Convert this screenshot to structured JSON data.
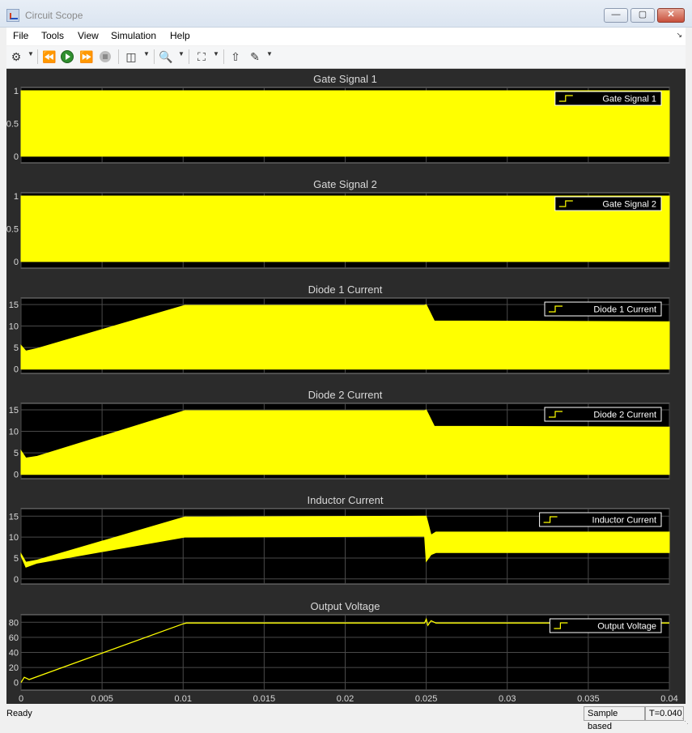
{
  "window": {
    "title": "Circuit Scope",
    "minimize_glyph": "—",
    "maximize_glyph": "▢",
    "close_glyph": "✕"
  },
  "menu": {
    "items": [
      "File",
      "Tools",
      "View",
      "Simulation",
      "Help"
    ]
  },
  "toolbar": {
    "icons": [
      "gear-icon",
      "step-back-icon",
      "run-icon",
      "step-forward-icon",
      "stop-icon",
      "signal-selector-icon",
      "zoom-in-icon",
      "autoscale-icon",
      "highlight-block-icon",
      "style-icon"
    ]
  },
  "status": {
    "left": "Ready",
    "sample": "Sample based",
    "time": "T=0.040"
  },
  "colors": {
    "background": "#2b2b2b",
    "axes": "#000000",
    "signal": "#ffff00",
    "grid": "#4a4a4a",
    "label": "#d9d9d9"
  },
  "chart_data": [
    {
      "type": "area",
      "title": "Gate Signal 1",
      "legend": "Gate Signal 1",
      "legend_position": "top-right",
      "ylim": [
        -0.1,
        1.05
      ],
      "yticks": [
        "0",
        "0.5",
        "1"
      ],
      "ytick_values": [
        0,
        0.5,
        1
      ],
      "grid": true,
      "envelope": {
        "x": [
          0,
          0.04
        ],
        "lower": [
          0,
          0
        ],
        "upper": [
          1,
          1
        ]
      }
    },
    {
      "type": "area",
      "title": "Gate Signal 2",
      "legend": "Gate Signal 2",
      "legend_position": "top-right",
      "ylim": [
        -0.1,
        1.05
      ],
      "yticks": [
        "0",
        "0.5",
        "1"
      ],
      "ytick_values": [
        0,
        0.5,
        1
      ],
      "grid": true,
      "envelope": {
        "x": [
          0,
          0.04
        ],
        "lower": [
          0,
          0
        ],
        "upper": [
          1,
          1
        ]
      }
    },
    {
      "type": "area",
      "title": "Diode 1 Current",
      "legend": "Diode 1 Current",
      "legend_position": "top-right",
      "ylim": [
        -1,
        16.5
      ],
      "yticks": [
        "0",
        "5",
        "10",
        "15"
      ],
      "ytick_values": [
        0,
        5,
        10,
        15
      ],
      "grid": true,
      "envelope": {
        "x": [
          0,
          0.0003,
          0.001,
          0.0101,
          0.0249,
          0.025,
          0.0255,
          0.04
        ],
        "lower": [
          0,
          0,
          0,
          0,
          0,
          0,
          0,
          0
        ],
        "upper": [
          5.5,
          4.2,
          4.8,
          14.8,
          14.8,
          15,
          11.2,
          11
        ]
      }
    },
    {
      "type": "area",
      "title": "Diode 2 Current",
      "legend": "Diode 2 Current",
      "legend_position": "top-right",
      "ylim": [
        -1,
        16.5
      ],
      "yticks": [
        "0",
        "5",
        "10",
        "15"
      ],
      "ytick_values": [
        0,
        5,
        10,
        15
      ],
      "grid": true,
      "envelope": {
        "x": [
          0,
          0.0003,
          0.001,
          0.0101,
          0.0249,
          0.025,
          0.0255,
          0.04
        ],
        "lower": [
          0,
          0,
          0,
          0,
          0,
          0,
          0,
          0
        ],
        "upper": [
          5.5,
          3.8,
          4.2,
          14.8,
          14.8,
          15,
          11.2,
          11
        ]
      }
    },
    {
      "type": "area",
      "title": "Inductor Current",
      "legend": "Inductor Current",
      "legend_position": "top-right",
      "ylim": [
        -1.2,
        16.8
      ],
      "yticks": [
        "0",
        "5",
        "10",
        "15"
      ],
      "ytick_values": [
        0,
        5,
        10,
        15
      ],
      "grid": true,
      "envelope": {
        "x": [
          0,
          0.0003,
          0.001,
          0.0101,
          0.0249,
          0.025,
          0.0253,
          0.0256,
          0.04
        ],
        "lower": [
          5.5,
          2.8,
          3.8,
          10,
          10.2,
          4.2,
          5.8,
          6.3,
          6.3
        ],
        "upper": [
          6,
          4,
          4.5,
          14.8,
          15,
          15,
          10.5,
          11.2,
          11.2
        ]
      }
    },
    {
      "type": "line",
      "title": "Output Voltage",
      "legend": "Output Voltage",
      "legend_position": "top-right",
      "ylim": [
        -10,
        90
      ],
      "yticks": [
        "0",
        "20",
        "40",
        "60",
        "80"
      ],
      "ytick_values": [
        0,
        20,
        40,
        60,
        80
      ],
      "grid": true,
      "x": [
        0,
        0.0002,
        0.0005,
        0.01,
        0.0102,
        0.0249,
        0.025,
        0.0251,
        0.0253,
        0.0256,
        0.04
      ],
      "y": [
        0,
        7,
        4,
        78,
        79,
        79,
        84,
        76,
        82,
        79,
        79
      ],
      "xlim": [
        0,
        0.04
      ],
      "xticks": [
        "0",
        "0.005",
        "0.01",
        "0.015",
        "0.02",
        "0.025",
        "0.03",
        "0.035",
        "0.04"
      ],
      "xtick_values": [
        0,
        0.005,
        0.01,
        0.015,
        0.02,
        0.025,
        0.03,
        0.035,
        0.04
      ]
    }
  ]
}
